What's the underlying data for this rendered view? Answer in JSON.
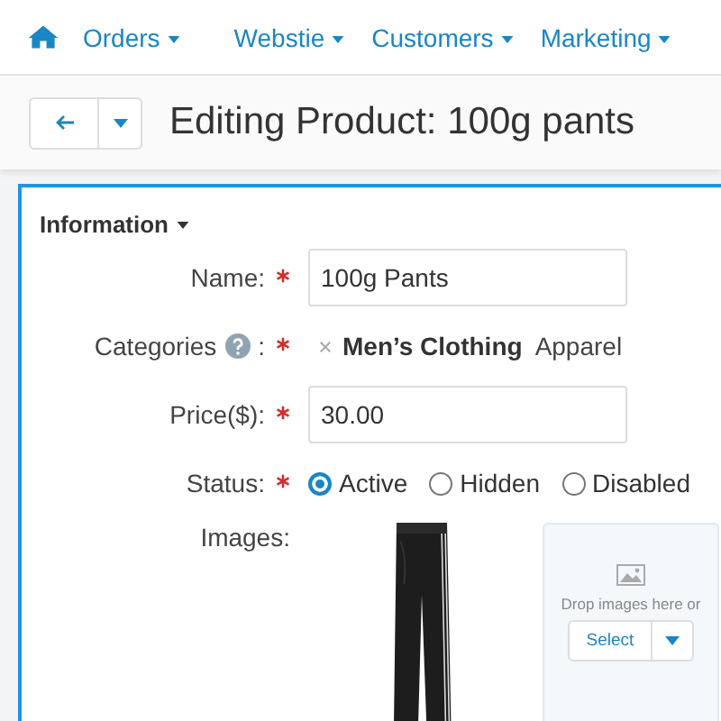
{
  "nav": {
    "items": [
      {
        "label": "Orders"
      },
      {
        "label": "Webstie"
      },
      {
        "label": "Customers"
      },
      {
        "label": "Marketing"
      }
    ]
  },
  "header": {
    "title": "Editing Product: 100g pants"
  },
  "section": {
    "title": "Information",
    "name": {
      "label": "Name:",
      "required": true,
      "value": "100g Pants"
    },
    "categories": {
      "label": "Categories",
      "required": true,
      "suffix": ":",
      "items": [
        {
          "label": "Men’s Clothing",
          "kind": "tag"
        },
        {
          "label": "Apparel",
          "kind": "plain"
        }
      ]
    },
    "price": {
      "label": "Price($):",
      "required": true,
      "value": "30.00"
    },
    "status": {
      "label": "Status:",
      "required": true,
      "options": [
        {
          "label": "Active",
          "selected": true
        },
        {
          "label": "Hidden",
          "selected": false
        },
        {
          "label": "Disabled",
          "selected": false
        }
      ]
    },
    "images": {
      "label": "Images:",
      "drop_text": "Drop images here or",
      "select_label": "Select"
    }
  }
}
